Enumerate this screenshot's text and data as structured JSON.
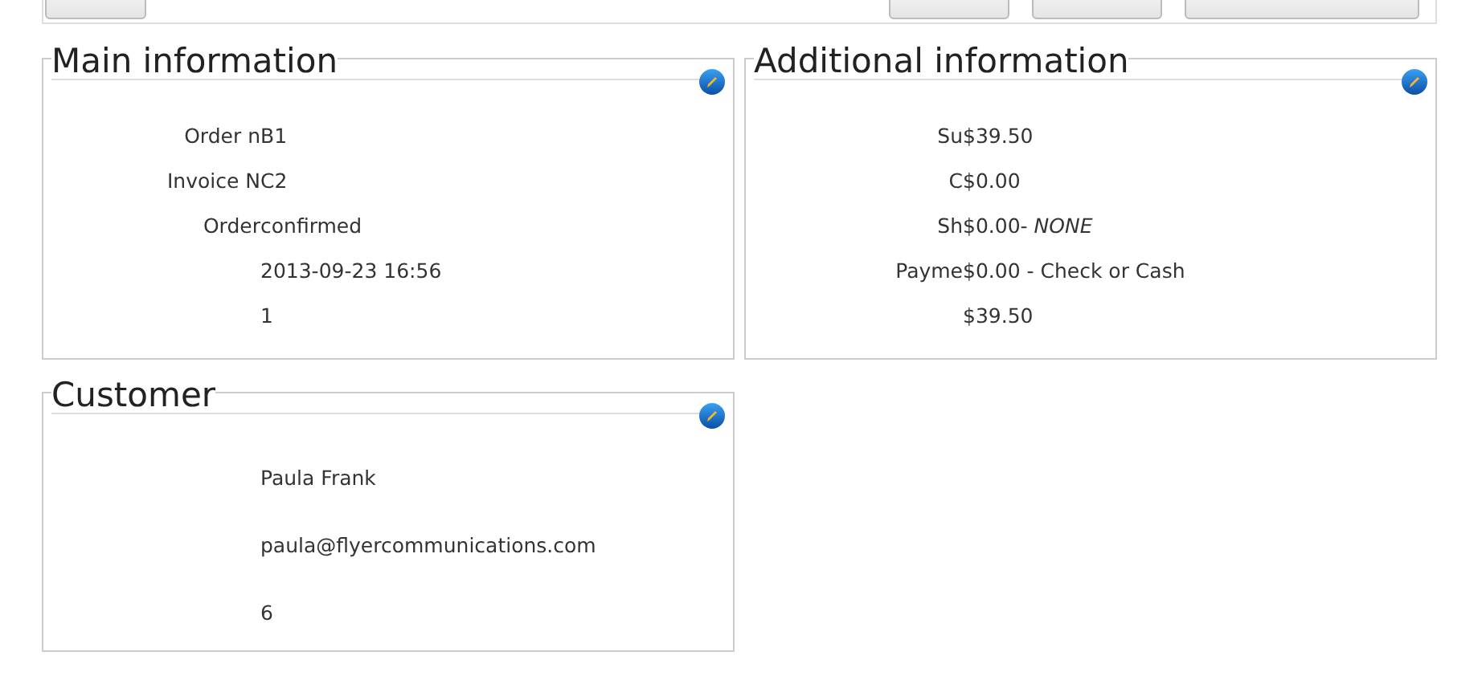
{
  "toolbar": {
    "buttons": [
      {
        "kind": "left"
      },
      {
        "kind": "right"
      },
      {
        "kind": "right"
      },
      {
        "kind": "right"
      }
    ]
  },
  "panels": [
    {
      "title": "Main information",
      "rows": [
        {
          "label": "Order n",
          "value": "B1"
        },
        {
          "label": "Invoice N",
          "value": "C2"
        },
        {
          "label": "Order",
          "value": "confirmed"
        },
        {
          "value": "2013-09-23 16:56"
        },
        {
          "value": "1"
        }
      ]
    },
    {
      "title": "Additional information",
      "rows": [
        {
          "label": "Su",
          "value": "$39.50"
        },
        {
          "label": "C",
          "value": "$0.00"
        },
        {
          "label": "Sh",
          "value": "$0.00- *NONE*"
        },
        {
          "label": "Payme",
          "value": "$0.00 - Check or Cash"
        },
        {
          "value": "$39.50"
        }
      ]
    },
    {
      "title": "Customer",
      "rows": [
        {
          "value": "Paula Frank"
        },
        {
          "value": "paula@flyercommunications.com"
        },
        {
          "value": "6"
        }
      ]
    }
  ]
}
